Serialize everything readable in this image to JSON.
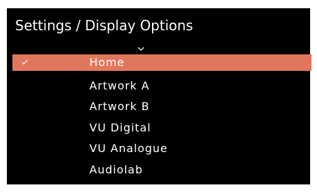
{
  "header": {
    "title": "Settings / Display Options"
  },
  "icons": {
    "scroll_up": "chevron-up-icon",
    "checkmark": "check-icon"
  },
  "colors": {
    "background": "#000000",
    "selection": "#e0775c",
    "text": "#ffffff"
  },
  "menu": {
    "selected_index": 0,
    "items": [
      {
        "label": "Home",
        "selected": true
      },
      {
        "label": "Artwork A",
        "selected": false
      },
      {
        "label": "Artwork B",
        "selected": false
      },
      {
        "label": "VU Digital",
        "selected": false
      },
      {
        "label": "VU Analogue",
        "selected": false
      },
      {
        "label": "Audiolab",
        "selected": false
      }
    ]
  }
}
